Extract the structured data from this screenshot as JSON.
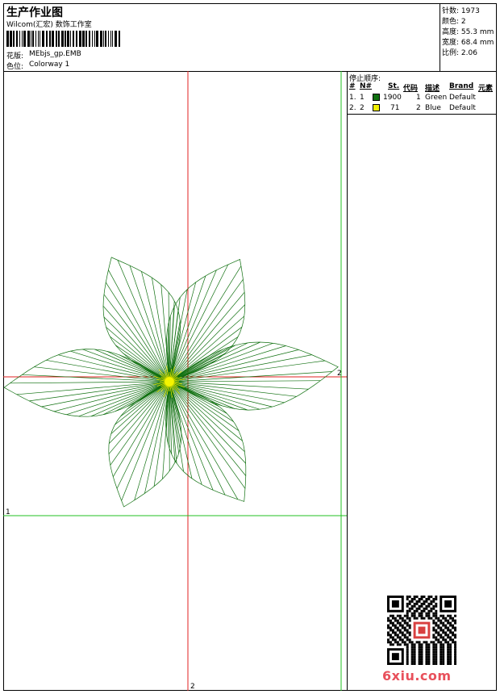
{
  "header": {
    "title": "生产作业图",
    "studio": "Wilcom(汇宏) 数饰工作室",
    "design_label": "花版:",
    "design_value": "MEbjs_gp.EMB",
    "colorway_label": "色位:",
    "colorway_value": "Colorway 1"
  },
  "stats": [
    {
      "label": "针数:",
      "value": "1973"
    },
    {
      "label": "颜色:",
      "value": "2"
    },
    {
      "label": "高度:",
      "value": "55.3 mm"
    },
    {
      "label": "宽度:",
      "value": "68.4 mm"
    },
    {
      "label": "比例:",
      "value": "2.06"
    }
  ],
  "stop_panel": {
    "title": "停止顺序:",
    "headers": {
      "num": "#",
      "n": "N#",
      "st": "St.",
      "code": "代码",
      "desc": "描述",
      "brand": "Brand",
      "elem": "元素"
    },
    "rows": [
      {
        "num": "1.",
        "n": "1",
        "color": "#107010",
        "st": "1900",
        "code": "1",
        "desc": "Green",
        "brand": "Default"
      },
      {
        "num": "2.",
        "n": "2",
        "color": "#f0f000",
        "st": "71",
        "code": "2",
        "desc": "Blue",
        "brand": "Default"
      }
    ]
  },
  "guides": {
    "h_red": "2",
    "v_red": "2",
    "h_green": "1"
  },
  "colors": {
    "thread_green": "#107010",
    "thread_yellow": "#e8e800",
    "guide_red": "#e02020",
    "guide_green": "#20c020"
  },
  "watermark": {
    "site": "6xiu.com",
    "icon": "qr-code-icon"
  }
}
